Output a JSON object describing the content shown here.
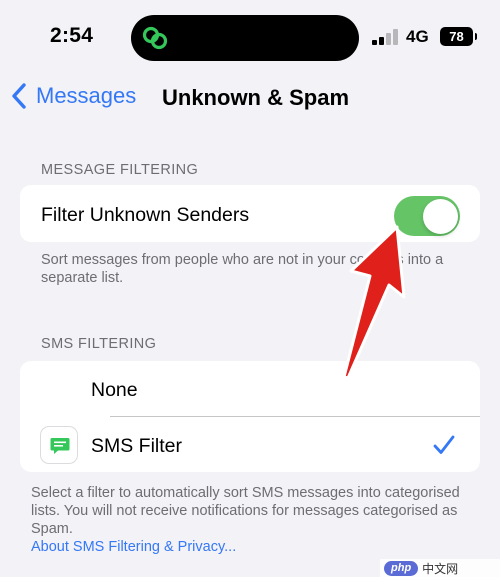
{
  "status_bar": {
    "time": "2:54",
    "network": "4G",
    "battery": "78"
  },
  "nav": {
    "back_label": "Messages",
    "title": "Unknown & Spam"
  },
  "message_filtering": {
    "header": "MESSAGE FILTERING",
    "row_label": "Filter Unknown Senders",
    "toggle_on": true,
    "footer": "Sort messages from people who are not in your contacts into a separate list."
  },
  "sms_filtering": {
    "header": "SMS FILTERING",
    "options": [
      {
        "label": "None",
        "selected": false
      },
      {
        "label": "SMS Filter",
        "selected": true
      }
    ],
    "footer": "Select a filter to automatically sort SMS messages into categorised lists. You will not receive notifications for messages categorised as Spam.",
    "link": "About SMS Filtering & Privacy..."
  },
  "watermark": {
    "badge": "php",
    "text": "中文网"
  },
  "colors": {
    "accent": "#3478f6",
    "toggle_on": "#65c466",
    "annotation_arrow": "#e0201b",
    "background": "#f2f2f7"
  }
}
